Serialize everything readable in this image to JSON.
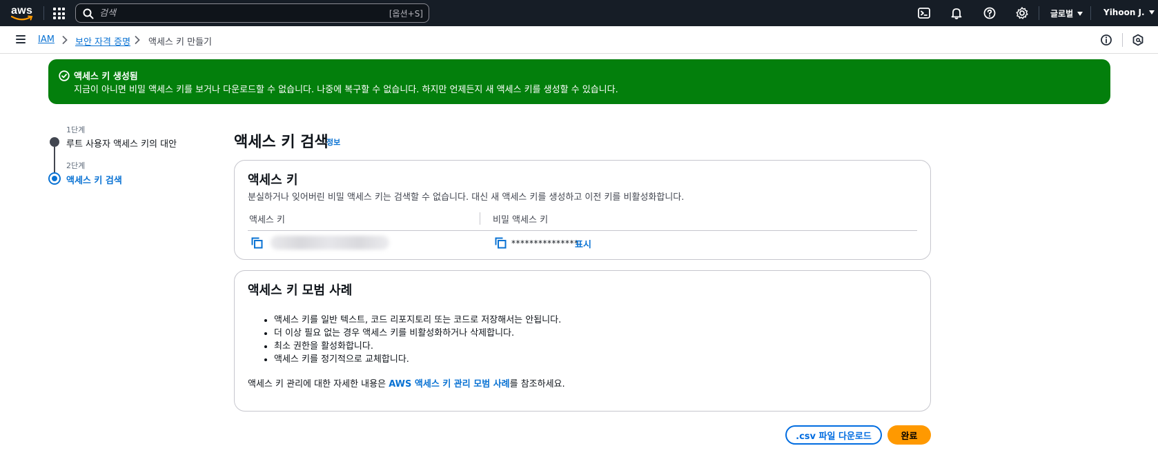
{
  "topnav": {
    "logo_text": "aws",
    "search": {
      "placeholder": "검색",
      "shortcut": "[옵션+S]"
    },
    "region": "글로벌",
    "user": "Yihoon J."
  },
  "breadcrumb": {
    "items": [
      "IAM",
      "보안 자격 증명",
      "액세스 키 만들기"
    ]
  },
  "flash": {
    "title": "액세스 키 생성됨",
    "message": "지금이 아니면 비밀 액세스 키를 보거나 다운로드할 수 없습니다. 나중에 복구할 수 없습니다. 하지만 언제든지 새 액세스 키를 생성할 수 있습니다."
  },
  "steps": [
    {
      "label": "1단계",
      "title": "루트 사용자 액세스 키의 대안",
      "state": "done"
    },
    {
      "label": "2단계",
      "title": "액세스 키 검색",
      "state": "active"
    }
  ],
  "main": {
    "title": "액세스 키 검색",
    "info_link": "정보",
    "access_key_container": {
      "title": "액세스 키",
      "description": "분실하거나 잊어버린 비밀 액세스 키는 검색할 수 없습니다. 대신 새 액세스 키를 생성하고 이전 키를 비활성화합니다.",
      "columns": [
        "액세스 키",
        "비밀 액세스 키"
      ],
      "secret_mask": "***************",
      "show_label": "표시"
    },
    "best_practices": {
      "title": "액세스 키 모범 사례",
      "items": [
        "액세스 키를 일반 텍스트, 코드 리포지토리 또는 코드로 저장해서는 안됩니다.",
        "더 이상 필요 없는 경우 액세스 키를 비활성화하거나 삭제합니다.",
        "최소 권한을 활성화합니다.",
        "액세스 키를 정기적으로 교체합니다."
      ],
      "footer_prefix": "액세스 키 관리에 대한 자세한 내용은 ",
      "footer_link": "AWS 액세스 키 관리 모범 사례",
      "footer_suffix": "를 참조하세요."
    }
  },
  "actions": {
    "download_csv": ".csv 파일 다운로드",
    "done": "완료"
  },
  "colors": {
    "nav_bg": "#161d26",
    "success": "#037f0c",
    "link": "#0972d3",
    "primary_button": "#ff9900"
  }
}
